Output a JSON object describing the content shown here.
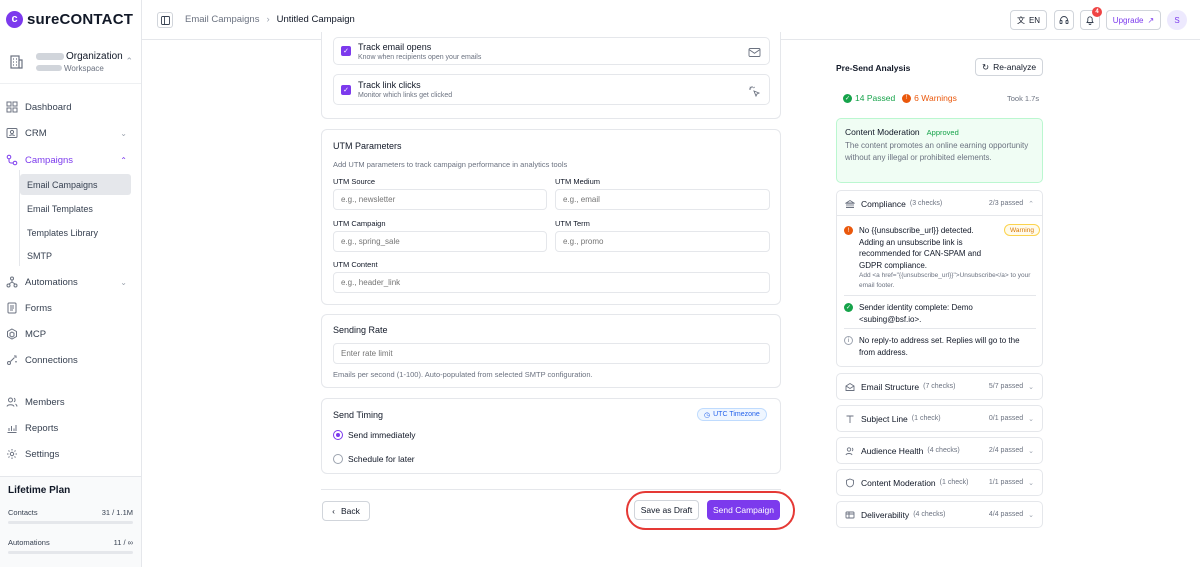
{
  "brand": {
    "name": "sureCONTACT",
    "accent": "#7c3aed"
  },
  "org": {
    "name": "Organization",
    "type": "Workspace"
  },
  "sidebar": {
    "items": [
      {
        "label": "Dashboard"
      },
      {
        "label": "CRM"
      },
      {
        "label": "Campaigns"
      },
      {
        "label": "Automations"
      },
      {
        "label": "Forms"
      },
      {
        "label": "MCP"
      },
      {
        "label": "Connections"
      },
      {
        "label": "Members"
      },
      {
        "label": "Reports"
      },
      {
        "label": "Settings"
      }
    ],
    "campaign_sub": [
      "Email Campaigns",
      "Email Templates",
      "Templates Library",
      "SMTP"
    ]
  },
  "plan": {
    "title": "Lifetime Plan",
    "contacts_label": "Contacts",
    "contacts_value": "31 / 1.1M",
    "contacts_fraction": 3e-05,
    "automations_label": "Automations",
    "automations_value": "11 / ∞",
    "automations_fraction": 0
  },
  "topbar": {
    "crumb_parent": "Email Campaigns",
    "crumb_current": "Untitled Campaign",
    "lang": "EN",
    "notif_count": "4",
    "upgrade": "Upgrade",
    "avatar": "S"
  },
  "tracking": {
    "opens_title": "Track email opens",
    "opens_desc": "Know when recipients open your emails",
    "clicks_title": "Track link clicks",
    "clicks_desc": "Monitor which links get clicked"
  },
  "utm": {
    "title": "UTM Parameters",
    "desc": "Add UTM parameters to track campaign performance in analytics tools",
    "source_label": "UTM Source",
    "source_ph": "e.g., newsletter",
    "medium_label": "UTM Medium",
    "medium_ph": "e.g., email",
    "campaign_label": "UTM Campaign",
    "campaign_ph": "e.g., spring_sale",
    "term_label": "UTM Term",
    "term_ph": "e.g., promo",
    "content_label": "UTM Content",
    "content_ph": "e.g., header_link"
  },
  "rate": {
    "title": "Sending Rate",
    "ph": "Enter rate limit",
    "help": "Emails per second (1-100). Auto-populated from selected SMTP configuration."
  },
  "timing": {
    "title": "Send Timing",
    "tz": "UTC Timezone",
    "immediate": "Send immediately",
    "later": "Schedule for later"
  },
  "actions": {
    "back": "Back",
    "draft": "Save as Draft",
    "send": "Send Campaign"
  },
  "analysis": {
    "title": "Pre-Send Analysis",
    "reanalyze": "Re-analyze",
    "passed": "14 Passed",
    "warnings": "6 Warnings",
    "took": "Took 1.7s",
    "moderation_title": "Content Moderation",
    "moderation_status": "Approved",
    "moderation_text": "The content promotes an online earning opportunity without any illegal or prohibited elements.",
    "compliance": {
      "title": "Compliance",
      "checks": "(3 checks)",
      "passed": "2/3 passed",
      "issue1": "No {{unsubscribe_url}} detected. Adding an unsubscribe link is recommended for CAN-SPAM and GDPR compliance.",
      "issue1_hint": "Add <a href=\"{{unsubscribe_url}}\">Unsubscribe</a> to your email footer.",
      "issue1_badge": "Warning",
      "issue2": "Sender identity complete: Demo <subing@bsf.io>.",
      "issue3": "No reply-to address set. Replies will go to the from address."
    },
    "sections": [
      {
        "title": "Email Structure",
        "checks": "(7 checks)",
        "passed": "5/7 passed"
      },
      {
        "title": "Subject Line",
        "checks": "(1 check)",
        "passed": "0/1 passed"
      },
      {
        "title": "Audience Health",
        "checks": "(4 checks)",
        "passed": "2/4 passed"
      },
      {
        "title": "Content Moderation",
        "checks": "(1 check)",
        "passed": "1/1 passed"
      },
      {
        "title": "Deliverability",
        "checks": "(4 checks)",
        "passed": "4/4 passed"
      }
    ]
  }
}
